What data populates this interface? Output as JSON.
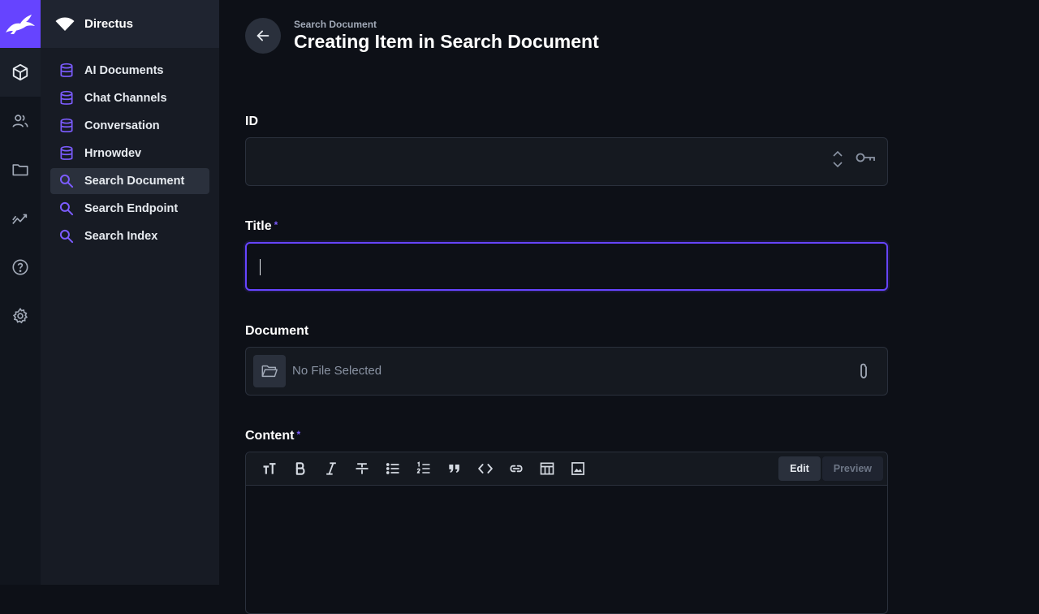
{
  "project": {
    "name": "Directus"
  },
  "rail": [
    "content-icon",
    "users-icon",
    "files-icon",
    "insights-icon",
    "help-icon",
    "settings-icon"
  ],
  "nav": {
    "items": [
      {
        "label": "AI Documents",
        "icon": "database-icon"
      },
      {
        "label": "Chat Channels",
        "icon": "database-icon"
      },
      {
        "label": "Conversation",
        "icon": "database-icon"
      },
      {
        "label": "Hrnowdev",
        "icon": "database-icon"
      },
      {
        "label": "Search Document",
        "icon": "search-icon",
        "active": true
      },
      {
        "label": "Search Endpoint",
        "icon": "search-icon"
      },
      {
        "label": "Search Index",
        "icon": "search-icon"
      }
    ]
  },
  "header": {
    "breadcrumb": "Search Document",
    "title": "Creating Item in Search Document"
  },
  "form": {
    "id": {
      "label": "ID",
      "value": ""
    },
    "title": {
      "label": "Title",
      "required_mark": "*",
      "value": ""
    },
    "document": {
      "label": "Document",
      "placeholder": "No File Selected"
    },
    "content": {
      "label": "Content",
      "required_mark": "*",
      "edit_label": "Edit",
      "preview_label": "Preview"
    }
  },
  "colors": {
    "accent": "#6644ff",
    "background": "#0d1017",
    "nav": "#171b24"
  }
}
